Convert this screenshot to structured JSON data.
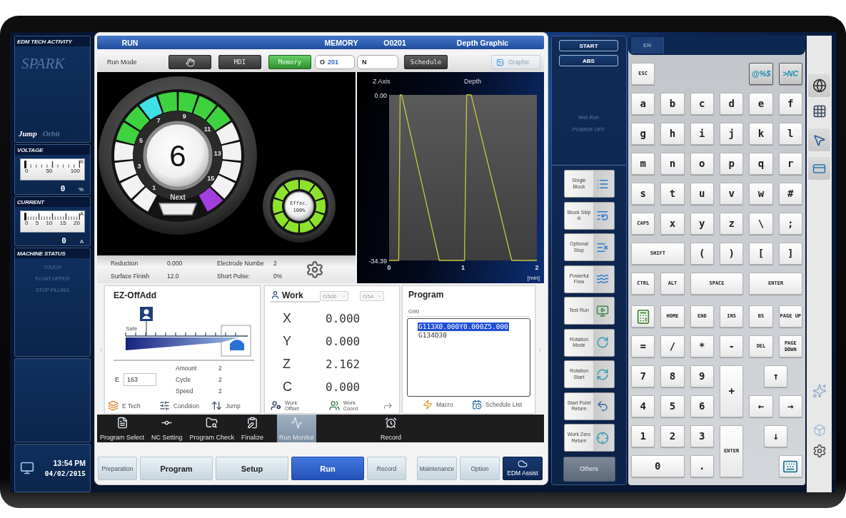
{
  "left_panel": {
    "activity": {
      "title": "EDM TECH ACTIVITY",
      "spark": {
        "label": "SPARK",
        "on": false
      },
      "modes": [
        {
          "label": "Jump",
          "on": true
        },
        {
          "label": "Orbit",
          "on": false
        }
      ]
    },
    "meters": [
      {
        "title": "VOLTAGE",
        "unit": "%",
        "scale": [
          "0",
          "50",
          "100"
        ],
        "level": 0,
        "reading": "0",
        "reading_unit": "%"
      },
      {
        "title": "CURRENT",
        "unit": "A",
        "scale": [
          "0",
          "5",
          "10",
          "15",
          "20"
        ],
        "level": 0,
        "reading": "0",
        "reading_unit": "A"
      }
    ],
    "machine_status": {
      "title": "MACHINE STATUS",
      "items": [
        {
          "label": "TOUCH",
          "on": false
        },
        {
          "label": "FLOAT UPPER",
          "on": false
        },
        {
          "label": "STOP FILLING",
          "on": false
        }
      ]
    },
    "clock": {
      "time": "13:54 PM",
      "date": "04/02/2015"
    }
  },
  "main_window": {
    "title_bar": {
      "mode": "RUN",
      "source": "MEMORY",
      "program": "O0201",
      "view": "Depth Graphic"
    },
    "toolbar": {
      "label": "Run Mode",
      "modes": [
        {
          "kind": "icon",
          "selected": false
        },
        {
          "kind": "text",
          "label": "MDI",
          "selected": false
        },
        {
          "kind": "text",
          "label": "Memory",
          "selected": true
        }
      ],
      "program_field": {
        "prefix": "O",
        "value": "201"
      },
      "sequence_field": {
        "prefix": "N"
      },
      "schedule_button": "Schedule",
      "graphic_button": "Graphic"
    },
    "gauge": {
      "value": "6",
      "next_label": "Next",
      "numbers": [
        "1",
        "3",
        "5",
        "7",
        "9",
        "11",
        "13",
        "15"
      ],
      "segments": [
        {
          "color": "#f2f2f2"
        },
        {
          "color": "#f2f2f2"
        },
        {
          "color": "#f2f2f2"
        },
        {
          "color": "#f2f2f2"
        },
        {
          "color": "#3fd23f"
        },
        {
          "color": "#3fd23f"
        },
        {
          "color": "#3ee0e6"
        },
        {
          "color": "#3fd23f"
        },
        {
          "color": "#3fd23f"
        },
        {
          "color": "#3fd23f"
        },
        {
          "color": "#3fd23f"
        },
        {
          "color": "#f2f2f2"
        },
        {
          "color": "#f2f2f2"
        },
        {
          "color": "#f2f2f2"
        },
        {
          "color": "#f2f2f2"
        },
        {
          "color": "#a23fe0"
        }
      ]
    },
    "efficiency": {
      "label": "Effec.",
      "reading": "100%",
      "level": 1
    },
    "info": [
      {
        "label": "Reduction",
        "value": "0.000"
      },
      {
        "label": "Electrode Numbe",
        "value": "2"
      },
      {
        "label": "Surface Finish",
        "value": "12.0"
      },
      {
        "label": "Short Pulse:",
        "value": "0%"
      }
    ],
    "depth_chart": {
      "depth_label": "Depth",
      "chart_data": {
        "type": "line",
        "ylabel": "Z Axis",
        "xlabel": "[min]",
        "x": [
          0,
          0.13,
          0.15,
          0.17,
          0.68,
          1.02,
          1.05,
          1.11,
          1.66,
          2
        ],
        "series": [
          {
            "color": "#c4c83e",
            "values": [
              -34.39,
              -34.39,
              0,
              0,
              -34.39,
              -34.39,
              0,
              0,
              -34.39,
              -34.39
            ]
          }
        ],
        "xlim": [
          0,
          2
        ],
        "ylim": [
          -34.39,
          0
        ],
        "xticks": [
          0,
          1,
          2
        ],
        "yticks": [
          {
            "value": 0,
            "label": "0.00"
          },
          {
            "value": -34.39,
            "label": "-34.39"
          }
        ]
      }
    },
    "ez_offadd": {
      "title": "EZ-OffAdd",
      "safe_label": "Safe",
      "e_field": {
        "label": "E",
        "value": "163"
      },
      "params": [
        {
          "label": "Amount",
          "value": "2"
        },
        {
          "label": "Cycle",
          "value": "2"
        },
        {
          "label": "Speed",
          "value": "2"
        }
      ],
      "actions": [
        "E Tech",
        "Condition",
        "Jump"
      ]
    },
    "work": {
      "title": "Work",
      "selectors": [
        "G500",
        "G54"
      ],
      "axes": [
        {
          "axis": "X",
          "value": "0.000"
        },
        {
          "axis": "Y",
          "value": "0.000"
        },
        {
          "axis": "Z",
          "value": "2.162"
        },
        {
          "axis": "C",
          "value": "0.000"
        }
      ],
      "actions": [
        "Work Offset",
        "Work Coord"
      ]
    },
    "program": {
      "title": "Program",
      "header_line": "G90",
      "lines": [
        {
          "text": "G113X0.000Y0.000Z5.000",
          "selected": true
        },
        {
          "text": "G134D30",
          "selected": false
        }
      ],
      "actions": [
        "Macro",
        "Schedule List"
      ]
    },
    "function_groups": [
      {
        "items": [
          {
            "label": "Program Select",
            "selected": false
          },
          {
            "label": "NC Setting",
            "selected": false
          },
          {
            "label": "Program Check",
            "selected": false
          },
          {
            "label": "Finalize",
            "selected": false
          }
        ]
      },
      {
        "items": [
          {
            "label": "Run Monitor",
            "selected": true
          }
        ]
      },
      {
        "items": [
          {
            "label": "Record",
            "selected": false
          }
        ]
      }
    ],
    "mode_tabs": [
      {
        "label": "Preparation",
        "kind": "minor",
        "selected": false
      },
      {
        "label": "Program",
        "kind": "major",
        "selected": false
      },
      {
        "label": "Setup",
        "kind": "major",
        "selected": false
      },
      {
        "label": "Run",
        "kind": "major",
        "selected": true
      },
      {
        "label": "Record",
        "kind": "minor",
        "selected": false
      }
    ],
    "utility_tabs": [
      {
        "label": "Maintenance",
        "selected": false
      },
      {
        "label": "Option",
        "selected": false
      }
    ],
    "assist_button": "EDM Assist"
  },
  "side_panel": {
    "toggles": [
      "START",
      "ABS"
    ],
    "indicators": [
      {
        "label": "Wet Run",
        "on": false
      },
      {
        "label": "POWER OFF",
        "on": false
      }
    ],
    "functions": [
      "Single Block",
      "Block Skip ⊘",
      "Optional Stop",
      "Powerful Flow",
      "Test Run",
      "Rotation Mode",
      "Rotation Start",
      "Start Point Return",
      "Work Zero Return"
    ],
    "others_button": "Others"
  },
  "keyboard": {
    "language_tab": {
      "label": "EN",
      "selected": true
    },
    "esc_key": "ESC",
    "macro_keys": [
      "@%$",
      ">NC"
    ],
    "letter_rows": [
      [
        "a",
        "b",
        "c",
        "d",
        "e",
        "f"
      ],
      [
        "g",
        "h",
        "i",
        "j",
        "k",
        "l"
      ],
      [
        "m",
        "n",
        "o",
        "p",
        "q",
        "r"
      ],
      [
        "s",
        "t",
        "u",
        "v",
        "w",
        "#"
      ],
      [
        "CAPS",
        "x",
        "y",
        "z",
        "\\",
        ";"
      ],
      [
        "SHIFT",
        "(",
        ")",
        "[",
        "]"
      ],
      [
        "CTRL",
        "ALT",
        "SPACE",
        "ENTER"
      ]
    ],
    "edit_rows": [
      [
        "HOME",
        "END",
        "INS",
        "BS",
        "PAGE UP"
      ],
      [
        "=",
        "/",
        "*",
        "-",
        "DEL",
        "PAGE DOWN"
      ]
    ],
    "numpad": {
      "rows": [
        [
          "7",
          "8",
          "9"
        ],
        [
          "4",
          "5",
          "6"
        ],
        [
          "1",
          "2",
          "3"
        ]
      ],
      "plus": "+",
      "enter": "ENTER",
      "zero": "0",
      "dot": "."
    },
    "arrows": [
      "↑",
      "←",
      "→",
      "↓"
    ]
  }
}
